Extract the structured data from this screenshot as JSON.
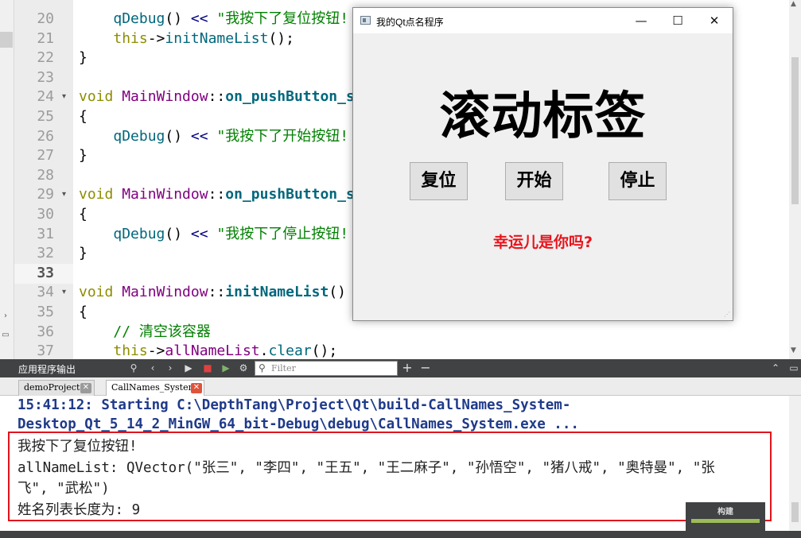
{
  "editor": {
    "lines": [
      {
        "num": "20",
        "segs": [
          {
            "c": "plain",
            "t": "    "
          },
          {
            "c": "fnc",
            "t": "qDebug"
          },
          {
            "c": "plain",
            "t": "() "
          },
          {
            "c": "op",
            "t": "<<"
          },
          {
            "c": "plain",
            "t": " "
          },
          {
            "c": "str",
            "t": "\"我按下了复位按钮!"
          }
        ]
      },
      {
        "num": "21",
        "segs": [
          {
            "c": "plain",
            "t": "    "
          },
          {
            "c": "k",
            "t": "this"
          },
          {
            "c": "plain",
            "t": "->"
          },
          {
            "c": "fnc",
            "t": "initNameList"
          },
          {
            "c": "plain",
            "t": "();"
          }
        ]
      },
      {
        "num": "22",
        "segs": [
          {
            "c": "plain",
            "t": "}"
          }
        ]
      },
      {
        "num": "23",
        "segs": []
      },
      {
        "num": "24",
        "fold": true,
        "segs": [
          {
            "c": "k",
            "t": "void"
          },
          {
            "c": "plain",
            "t": " "
          },
          {
            "c": "t",
            "t": "MainWindow"
          },
          {
            "c": "plain",
            "t": "::"
          },
          {
            "c": "fn",
            "t": "on_pushButton_s"
          }
        ]
      },
      {
        "num": "25",
        "segs": [
          {
            "c": "plain",
            "t": "{"
          }
        ]
      },
      {
        "num": "26",
        "segs": [
          {
            "c": "plain",
            "t": "    "
          },
          {
            "c": "fnc",
            "t": "qDebug"
          },
          {
            "c": "plain",
            "t": "() "
          },
          {
            "c": "op",
            "t": "<<"
          },
          {
            "c": "plain",
            "t": " "
          },
          {
            "c": "str",
            "t": "\"我按下了开始按钮!"
          }
        ]
      },
      {
        "num": "27",
        "segs": [
          {
            "c": "plain",
            "t": "}"
          }
        ]
      },
      {
        "num": "28",
        "segs": []
      },
      {
        "num": "29",
        "fold": true,
        "segs": [
          {
            "c": "k",
            "t": "void"
          },
          {
            "c": "plain",
            "t": " "
          },
          {
            "c": "t",
            "t": "MainWindow"
          },
          {
            "c": "plain",
            "t": "::"
          },
          {
            "c": "fn",
            "t": "on_pushButton_s"
          }
        ]
      },
      {
        "num": "30",
        "segs": [
          {
            "c": "plain",
            "t": "{"
          }
        ]
      },
      {
        "num": "31",
        "segs": [
          {
            "c": "plain",
            "t": "    "
          },
          {
            "c": "fnc",
            "t": "qDebug"
          },
          {
            "c": "plain",
            "t": "() "
          },
          {
            "c": "op",
            "t": "<<"
          },
          {
            "c": "plain",
            "t": " "
          },
          {
            "c": "str",
            "t": "\"我按下了停止按钮!"
          }
        ]
      },
      {
        "num": "32",
        "segs": [
          {
            "c": "plain",
            "t": "}"
          }
        ]
      },
      {
        "num": "33",
        "current": true,
        "segs": []
      },
      {
        "num": "34",
        "fold": true,
        "segs": [
          {
            "c": "k",
            "t": "void"
          },
          {
            "c": "plain",
            "t": " "
          },
          {
            "c": "t",
            "t": "MainWindow"
          },
          {
            "c": "plain",
            "t": "::"
          },
          {
            "c": "fn",
            "t": "initNameList"
          },
          {
            "c": "plain",
            "t": "()"
          }
        ]
      },
      {
        "num": "35",
        "segs": [
          {
            "c": "plain",
            "t": "{"
          }
        ]
      },
      {
        "num": "36",
        "segs": [
          {
            "c": "plain",
            "t": "    "
          },
          {
            "c": "cm",
            "t": "// 清空该容器"
          }
        ]
      },
      {
        "num": "37",
        "segs": [
          {
            "c": "plain",
            "t": "    "
          },
          {
            "c": "k",
            "t": "this"
          },
          {
            "c": "plain",
            "t": "->"
          },
          {
            "c": "t",
            "t": "allNameList"
          },
          {
            "c": "plain",
            "t": "."
          },
          {
            "c": "fnc",
            "t": "clear"
          },
          {
            "c": "plain",
            "t": "();"
          }
        ]
      }
    ]
  },
  "app_window": {
    "title": "我的Qt点名程序",
    "heading": "滚动标签",
    "buttons": {
      "reset": "复位",
      "start": "开始",
      "stop": "停止"
    },
    "status_text": "幸运儿是你吗?"
  },
  "output_pane": {
    "title": "应用程序输出",
    "filter_placeholder": "Filter",
    "tabs": [
      {
        "label": "demoProject",
        "close_color": "#9a9a9a"
      },
      {
        "label": "CallNames_System",
        "close_color": "#e0533a"
      }
    ],
    "start_lines": [
      "15:41:12: Starting C:\\DepthTang\\Project\\Qt\\build-CallNames_System-",
      "Desktop_Qt_5_14_2_MinGW_64_bit-Debug\\debug\\CallNames_System.exe ..."
    ],
    "log_lines": [
      "我按下了复位按钮!",
      "allNameList: QVector(\"张三\", \"李四\", \"王五\", \"王二麻子\", \"孙悟空\", \"猪八戒\", \"奥特曼\", \"张",
      "飞\", \"武松\")",
      "姓名列表长度为: 9"
    ],
    "build_label": "构建"
  },
  "colors": {
    "highlight_box": "#e0141c",
    "status_text": "#e8141c"
  }
}
